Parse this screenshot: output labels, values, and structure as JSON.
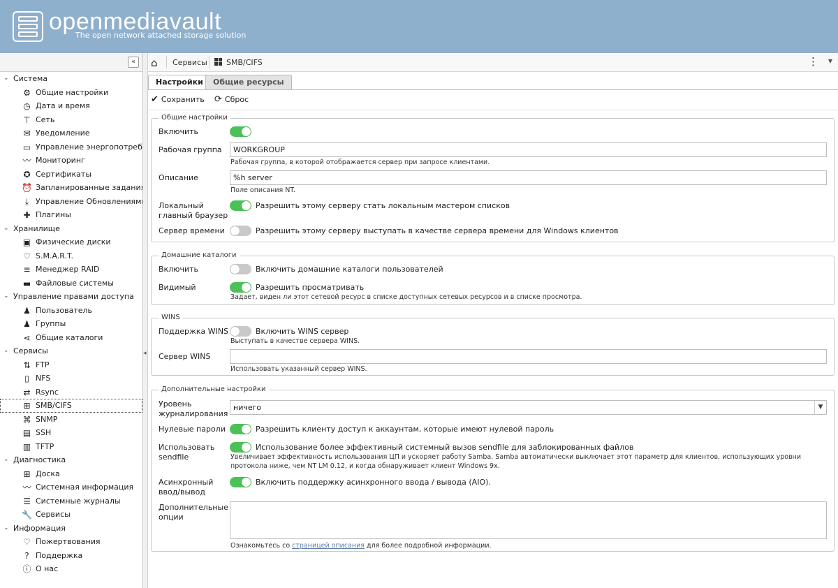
{
  "app": {
    "title": "openmediavault",
    "subtitle": "The open network attached storage solution"
  },
  "sidebar": {
    "collapse_glyph": "«",
    "sections": [
      {
        "label": "Система",
        "items": [
          {
            "label": "Общие настройки",
            "icon": "gears-icon",
            "glyph": "⚙"
          },
          {
            "label": "Дата и время",
            "icon": "clock-icon",
            "glyph": "◷"
          },
          {
            "label": "Сеть",
            "icon": "network-icon",
            "glyph": "⊤"
          },
          {
            "label": "Уведомление",
            "icon": "envelope-icon",
            "glyph": "✉"
          },
          {
            "label": "Управление энергопотреблением",
            "icon": "power-icon",
            "glyph": "▭"
          },
          {
            "label": "Мониторинг",
            "icon": "chart-line-icon",
            "glyph": "〰"
          },
          {
            "label": "Сертификаты",
            "icon": "certificate-icon",
            "glyph": "✪"
          },
          {
            "label": "Запланированные задания",
            "icon": "alarm-clock-icon",
            "glyph": "⏰"
          },
          {
            "label": "Управление Обновлениями",
            "icon": "download-icon",
            "glyph": "⤓"
          },
          {
            "label": "Плагины",
            "icon": "puzzle-icon",
            "glyph": "✚"
          }
        ]
      },
      {
        "label": "Хранилище",
        "items": [
          {
            "label": "Физические диски",
            "icon": "disk-icon",
            "glyph": "▣"
          },
          {
            "label": "S.M.A.R.T.",
            "icon": "heartbeat-icon",
            "glyph": "♡"
          },
          {
            "label": "Менеджер RAID",
            "icon": "database-icon",
            "glyph": "≡"
          },
          {
            "label": "Файловые системы",
            "icon": "folder-icon",
            "glyph": "▬"
          }
        ]
      },
      {
        "label": "Управление правами доступа",
        "items": [
          {
            "label": "Пользователь",
            "icon": "user-icon",
            "glyph": "♟"
          },
          {
            "label": "Группы",
            "icon": "users-icon",
            "glyph": "♟"
          },
          {
            "label": "Общие каталоги",
            "icon": "share-icon",
            "glyph": "⋖"
          }
        ]
      },
      {
        "label": "Сервисы",
        "items": [
          {
            "label": "FTP",
            "icon": "ftp-icon",
            "glyph": "⇅"
          },
          {
            "label": "NFS",
            "icon": "file-icon",
            "glyph": "▯"
          },
          {
            "label": "Rsync",
            "icon": "sync-icon",
            "glyph": "⇄"
          },
          {
            "label": "SMB/CIFS",
            "icon": "windows-icon",
            "glyph": "⊞",
            "selected": true
          },
          {
            "label": "SNMP",
            "icon": "sitemap-icon",
            "glyph": "⌘"
          },
          {
            "label": "SSH",
            "icon": "terminal-icon",
            "glyph": "▤"
          },
          {
            "label": "TFTP",
            "icon": "tftp-icon",
            "glyph": "▥"
          }
        ]
      },
      {
        "label": "Диагностика",
        "items": [
          {
            "label": "Доска",
            "icon": "grid-icon",
            "glyph": "⊞"
          },
          {
            "label": "Системная информация",
            "icon": "chart-line-icon",
            "glyph": "〰"
          },
          {
            "label": "Системные журналы",
            "icon": "list-icon",
            "glyph": "☰"
          },
          {
            "label": "Сервисы",
            "icon": "wrench-icon",
            "glyph": "🔧"
          }
        ]
      },
      {
        "label": "Информация",
        "items": [
          {
            "label": "Пожертвования",
            "icon": "heart-icon",
            "glyph": "♡"
          },
          {
            "label": "Поддержка",
            "icon": "question-icon",
            "glyph": "?"
          },
          {
            "label": "О нас",
            "icon": "info-icon",
            "glyph": "ⓘ"
          }
        ]
      }
    ]
  },
  "breadcrumb": {
    "home_glyph": "⌂",
    "items": [
      "Сервисы",
      "SMB/CIFS"
    ],
    "menu_glyph": "⋮",
    "drop_glyph": "▼"
  },
  "tabs": [
    {
      "label": "Настройки",
      "active": true
    },
    {
      "label": "Общие ресурсы",
      "active": false
    }
  ],
  "toolbar": {
    "save_label": "Сохранить",
    "save_glyph": "✔",
    "reset_label": "Сброс",
    "reset_glyph": "⟳"
  },
  "general": {
    "legend": "Общие настройки",
    "enable_label": "Включить",
    "enable_on": true,
    "workgroup_label": "Рабочая группа",
    "workgroup_value": "WORKGROUP",
    "workgroup_hint": "Рабочая группа, в которой отображается сервер при запросе клиентами.",
    "description_label": "Описание",
    "description_value": "%h server",
    "description_hint": "Поле описания NT.",
    "local_browser_label_1": "Локальный",
    "local_browser_label_2": "главный браузер",
    "local_browser_text": "Разрешить этому серверу стать локальным мастером списков",
    "local_browser_on": true,
    "time_server_label": "Сервер времени",
    "time_server_text": "Разрешить этому серверу выступать в качестве сервера времени для Windows клиентов",
    "time_server_on": false
  },
  "homes": {
    "legend": "Домашние каталоги",
    "enable_label": "Включить",
    "enable_text": "Включить домашние каталоги пользователей",
    "enable_on": false,
    "visible_label": "Видимый",
    "visible_text": "Разрешить просматривать",
    "visible_on": true,
    "visible_hint": "Задает, виден ли этот сетевой ресурс в списке доступных сетевых ресурсов и в списке просмотра."
  },
  "wins": {
    "legend": "WINS",
    "support_label": "Поддержка WINS",
    "support_text": "Включить WINS сервер",
    "support_on": false,
    "support_hint": "Выступать в качестве сервера WINS.",
    "server_label": "Сервер WINS",
    "server_value": "",
    "server_hint": "Использовать указанный сервер WINS."
  },
  "advanced": {
    "legend": "Дополнительные настройки",
    "log_label_1": "Уровень",
    "log_label_2": "журналирования",
    "log_value": "ничего",
    "null_pw_label": "Нулевые пароли",
    "null_pw_text": "Разрешить клиенту доступ к аккаунтам, которые имеют нулевой пароль",
    "null_pw_on": true,
    "sendfile_label_1": "Использовать",
    "sendfile_label_2": "sendfile",
    "sendfile_text": "Использование более эффективный системный вызов sendfile для заблокированных файлов",
    "sendfile_on": true,
    "sendfile_hint_1": "Увеличивает эффективность использования ЦП и ускоряет работу Samba. Samba автоматически выключает этот параметр для клиентов, использующих уровни",
    "sendfile_hint_2": "протокола ниже, чем NT LM 0.12, и когда обнаруживает клиент Windows 9x.",
    "aio_label_1": "Асинхронный",
    "aio_label_2": "ввод/вывод",
    "aio_text": "Включить поддержку асинхронного ввода / вывода (AIO).",
    "aio_on": true,
    "extra_label_1": "Дополнительные",
    "extra_label_2": "опции",
    "extra_value": "",
    "extra_hint_pre": "Ознакомьтесь со ",
    "extra_hint_link": "страницей описания",
    "extra_hint_post": " для более подробной информации."
  }
}
